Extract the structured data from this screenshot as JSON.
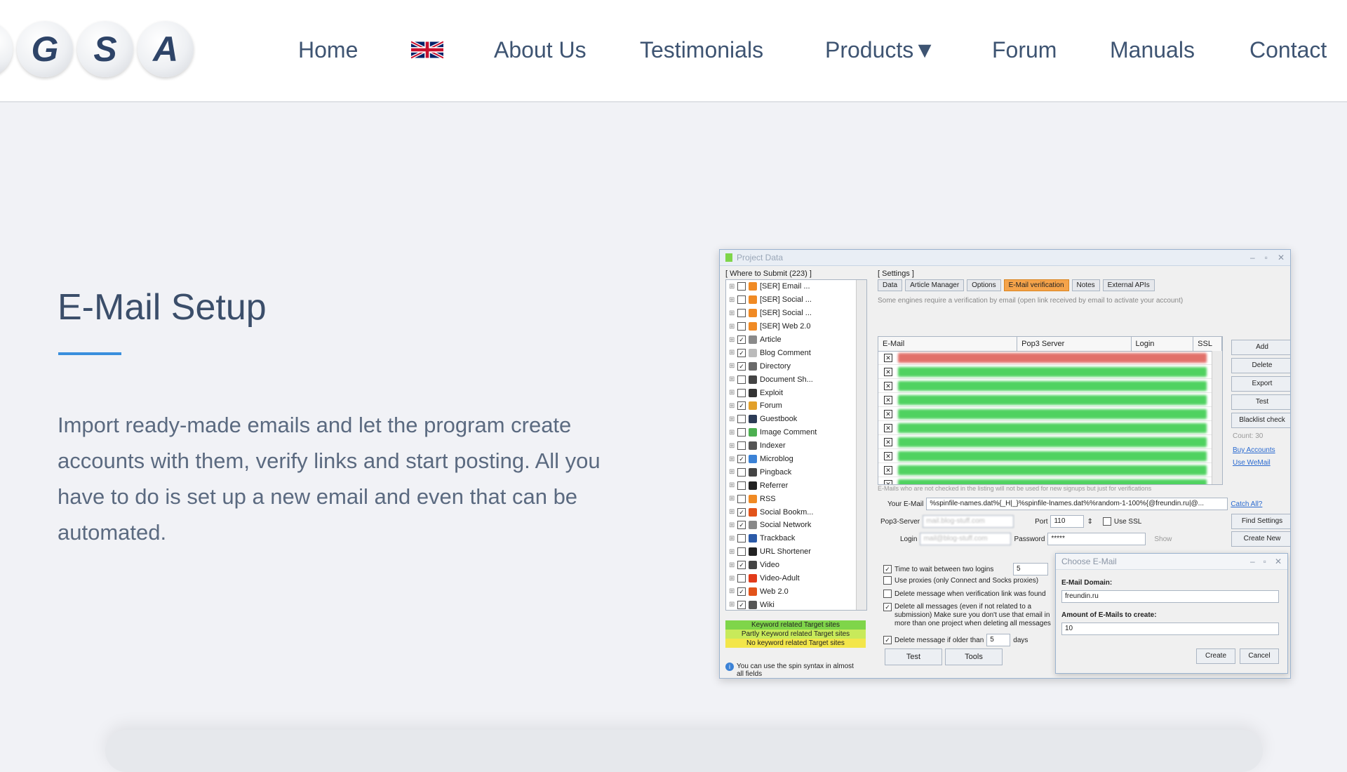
{
  "header": {
    "logo_letters": [
      "G",
      "S",
      "A"
    ],
    "nav": [
      {
        "label": "Home"
      },
      {
        "label": "About Us"
      },
      {
        "label": "Testimonials"
      },
      {
        "label": "Products▼"
      },
      {
        "label": "Forum"
      },
      {
        "label": "Manuals"
      },
      {
        "label": "Contact"
      }
    ],
    "flag_icon": "uk-flag-icon"
  },
  "main": {
    "title": "E-Mail Setup",
    "description": "Import ready-made emails and let the program create accounts with them, verify links and start posting. All you have to do is set up a new email and even that can be automated."
  },
  "app": {
    "window_title": "Project Data",
    "where_to_submit": "[ Where to Submit (223) ]",
    "tree": [
      {
        "label": "[SER] Email ...",
        "checked": false,
        "color": "#f08a24"
      },
      {
        "label": "[SER] Social ...",
        "checked": false,
        "color": "#f08a24"
      },
      {
        "label": "[SER] Social ...",
        "checked": false,
        "color": "#f08a24"
      },
      {
        "label": "[SER] Web 2.0",
        "checked": false,
        "color": "#f08a24"
      },
      {
        "label": "Article",
        "checked": true,
        "color": "#8a8a8a"
      },
      {
        "label": "Blog Comment",
        "checked": true,
        "color": "#bbbbbb"
      },
      {
        "label": "Directory",
        "checked": true,
        "color": "#6a6a6a"
      },
      {
        "label": "Document Sh...",
        "checked": false,
        "color": "#444444"
      },
      {
        "label": "Exploit",
        "checked": false,
        "color": "#333333"
      },
      {
        "label": "Forum",
        "checked": true,
        "color": "#e2a02a"
      },
      {
        "label": "Guestbook",
        "checked": false,
        "color": "#2c3b55"
      },
      {
        "label": "Image Comment",
        "checked": false,
        "color": "#4caf50"
      },
      {
        "label": "Indexer",
        "checked": false,
        "color": "#555555"
      },
      {
        "label": "Microblog",
        "checked": true,
        "color": "#3b82d6"
      },
      {
        "label": "Pingback",
        "checked": false,
        "color": "#444444"
      },
      {
        "label": "Referrer",
        "checked": false,
        "color": "#222222"
      },
      {
        "label": "RSS",
        "checked": false,
        "color": "#f08a24"
      },
      {
        "label": "Social Bookm...",
        "checked": true,
        "color": "#e2531a"
      },
      {
        "label": "Social Network",
        "checked": true,
        "color": "#888888"
      },
      {
        "label": "Trackback",
        "checked": false,
        "color": "#2b5aa8"
      },
      {
        "label": "URL Shortener",
        "checked": false,
        "color": "#222222"
      },
      {
        "label": "Video",
        "checked": true,
        "color": "#444444"
      },
      {
        "label": "Video-Adult",
        "checked": false,
        "color": "#e23b1a"
      },
      {
        "label": "Web 2.0",
        "checked": true,
        "color": "#e2531a"
      },
      {
        "label": "Wiki",
        "checked": true,
        "color": "#555555"
      }
    ],
    "legend": [
      {
        "label": "Keyword related Target sites",
        "color": "#7fd54a"
      },
      {
        "label": "Partly Keyword related Target sites",
        "color": "#c8ea5a"
      },
      {
        "label": "No keyword related Target sites",
        "color": "#f3e64a"
      }
    ],
    "tip": "You can use the spin syntax in almost all fields",
    "settings_label": "[ Settings ]",
    "tabs": [
      {
        "label": "Data",
        "active": false
      },
      {
        "label": "Article Manager",
        "active": false
      },
      {
        "label": "Options",
        "active": false
      },
      {
        "label": "E-Mail verification",
        "active": true
      },
      {
        "label": "Notes",
        "active": false
      },
      {
        "label": "External APIs",
        "active": false
      }
    ],
    "hint": "Some engines require a verification by email (open link received by email to activate your account)",
    "grid_headers": [
      "E-Mail",
      "Pop3 Server",
      "Login",
      "SSL"
    ],
    "grid_rows": [
      {
        "status": "red"
      },
      {
        "status": "green"
      },
      {
        "status": "green"
      },
      {
        "status": "green"
      },
      {
        "status": "green"
      },
      {
        "status": "green"
      },
      {
        "status": "green"
      },
      {
        "status": "green"
      },
      {
        "status": "green"
      },
      {
        "status": "green"
      }
    ],
    "side_buttons": [
      "Add",
      "Delete",
      "Export",
      "Test",
      "Blacklist check"
    ],
    "count_label": "Count: 30",
    "buy_accounts": "Buy Accounts",
    "use_wemail": "Use WeMail",
    "below_grid_note": "E-Mails who are not checked in the listing will not be used for new signups but just for verifications",
    "your_email_label": "Your E-Mail",
    "your_email_value": "%spinfile-names.dat%{_H|_}%spinfile-lnames.dat%%random-1-100%{@freundin.ru|@...",
    "catch_all": "Catch All?",
    "pop3_label": "Pop3-Server",
    "pop3_value": "mail.blog-stuff.com",
    "port_label": "Port",
    "port_value": "110",
    "use_ssl_label": "Use SSL",
    "find_settings": "Find Settings",
    "login_label": "Login",
    "login_value": "mail@blog-stuff.com",
    "password_label": "Password",
    "password_value": "*****",
    "show_label": "Show",
    "create_new": "Create New",
    "options": [
      {
        "label": "Time to wait between two logins",
        "checked": true,
        "value": "5"
      },
      {
        "label": "Use proxies (only Connect and Socks proxies)",
        "checked": false
      },
      {
        "label": "Delete message when verification link was found",
        "checked": false
      },
      {
        "label": "Delete all messages (even if not related to a submission) Make sure you don't use that email in more than one project when deleting all messages",
        "checked": true
      },
      {
        "label": "Delete message if older than",
        "checked": true,
        "value": "5",
        "unit": "days"
      }
    ],
    "test_button": "Test",
    "tools_button": "Tools",
    "dialog": {
      "title": "Choose E-Mail",
      "domain_label": "E-Mail Domain:",
      "domain_value": "freundin.ru",
      "amount_label": "Amount of E-Mails to create:",
      "amount_value": "10",
      "create_button": "Create",
      "cancel_button": "Cancel"
    }
  }
}
